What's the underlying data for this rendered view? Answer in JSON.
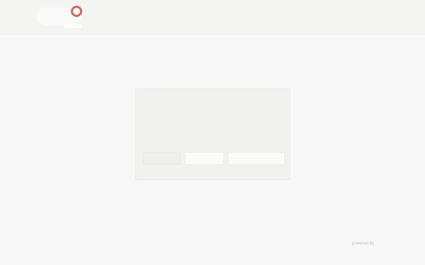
{
  "header": {
    "logo_icon": "brand-logo-icon",
    "accent_color": "#d9655a"
  },
  "dialog": {
    "title": "",
    "body_lines": [
      "",
      "",
      ""
    ],
    "buttons": {
      "accept_label": "",
      "settings_label": "",
      "reject_label": ""
    },
    "footer_text": ""
  },
  "footer": {
    "link_text": "powered by"
  }
}
